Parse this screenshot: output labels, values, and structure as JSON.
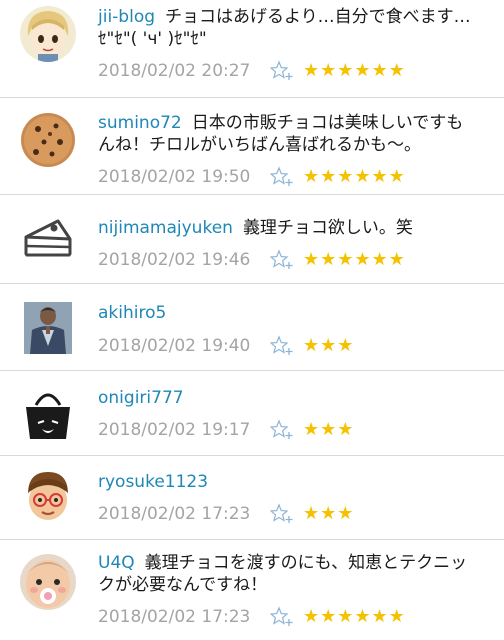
{
  "comments": [
    {
      "user": "jii-blog",
      "text": "チョコはあげるより…自分で食べます…ｾ\"ｾ\"( 'ч' )ｾ\"ｾ\"",
      "time": "2018/02/02 20:27",
      "stars": "★★★★★★",
      "avatar_icon": "anime-avatar-icon"
    },
    {
      "user": "sumino72",
      "text": "日本の市販チョコは美味しいですもんね！チロルがいちばん喜ばれるかも〜。",
      "time": "2018/02/02 19:50",
      "stars": "★★★★★★",
      "avatar_icon": "cookie-avatar-icon"
    },
    {
      "user": "nijimamajyuken",
      "text": "義理チョコ欲しい。笑",
      "time": "2018/02/02 19:46",
      "stars": "★★★★★★",
      "avatar_icon": "cake-avatar-icon"
    },
    {
      "user": "akihiro5",
      "text": "",
      "time": "2018/02/02 19:40",
      "stars": "★★★",
      "avatar_icon": "photo-avatar-icon"
    },
    {
      "user": "onigiri777",
      "text": "",
      "time": "2018/02/02 19:17",
      "stars": "★★★",
      "avatar_icon": "bag-avatar-icon"
    },
    {
      "user": "ryosuke1123",
      "text": "",
      "time": "2018/02/02 17:23",
      "stars": "★★★",
      "avatar_icon": "cartoon-face-avatar-icon"
    },
    {
      "user": "U4Q",
      "text": "義理チョコを渡すのにも、知恵とテクニックが必要なんですね！",
      "time": "2018/02/02 17:23",
      "stars": "★★★★★★",
      "avatar_icon": "baby-photo-avatar-icon"
    }
  ],
  "colors": {
    "username": "#1f87b6",
    "timestamp": "#a4a4a4",
    "star": "#f4c200",
    "add_star": "#8ab4d8",
    "divider": "#d9d9d9"
  }
}
